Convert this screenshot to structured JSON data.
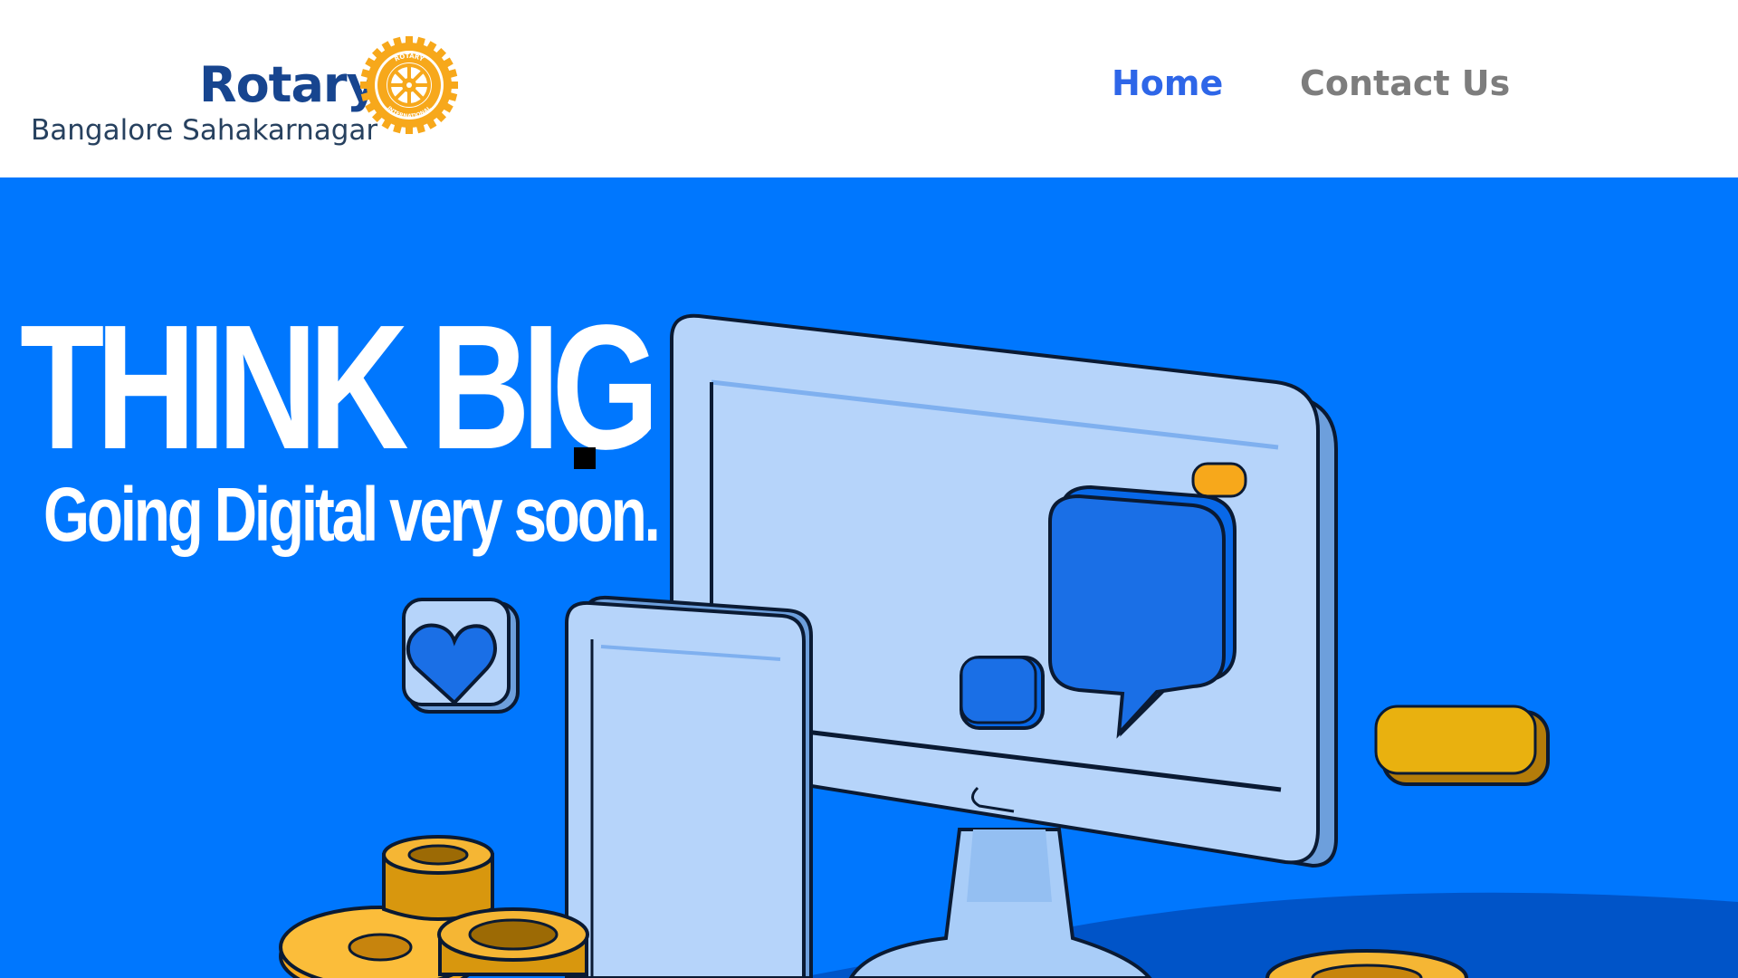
{
  "header": {
    "logo": {
      "wordmark": "Rotary",
      "subtitle": "Bangalore Sahakarnagar",
      "wheel_text_top": "ROTARY",
      "wheel_text_bottom": "INTERNATIONAL",
      "wheel_icon": "rotary-wheel-icon",
      "brand_color": "#17458f",
      "wheel_color": "#f7a81b"
    },
    "nav": {
      "items": [
        {
          "label": "Home",
          "active": true,
          "color": "#2e66e8"
        },
        {
          "label": "Contact Us",
          "active": false,
          "color": "#7d7d7d"
        }
      ]
    }
  },
  "hero": {
    "background": "#0077fe",
    "title": "THINK BIG",
    "subtitle": "Going Digital very soon.",
    "illustration": {
      "icons": [
        "monitor-icon",
        "tablet-icon",
        "chat-bubble-icon",
        "heart-icon",
        "gear-icon"
      ],
      "accent_orange": "#f7a81b",
      "accent_yellow": "#e9b10f",
      "screen_color": "#b8d6fb"
    }
  }
}
